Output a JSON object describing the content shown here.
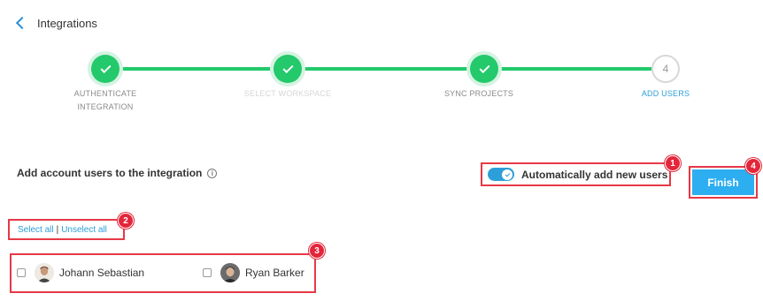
{
  "header": {
    "back_label": "Integrations"
  },
  "stepper": {
    "steps": [
      {
        "label_line1": "AUTHENTICATE",
        "label_line2": "INTEGRATION",
        "status": "done"
      },
      {
        "label_line1": "SELECT WORKSPACE",
        "label_line2": "",
        "status": "done-faded"
      },
      {
        "label_line1": "SYNC PROJECTS",
        "label_line2": "",
        "status": "done"
      },
      {
        "label_line1": "ADD USERS",
        "label_line2": "",
        "status": "current",
        "number": "4"
      }
    ]
  },
  "main": {
    "add_users_label": "Add account users to the integration",
    "info_icon_glyph": "i",
    "auto_add_label": "Automatically add new users",
    "auto_add_enabled": true,
    "finish_label": "Finish",
    "select_all_label": "Select all",
    "separator": "|",
    "unselect_all_label": "Unselect all",
    "users": [
      {
        "name": "Johann Sebastian",
        "checked": false
      },
      {
        "name": "Ryan Barker",
        "checked": false
      }
    ]
  },
  "annotations": {
    "badges": [
      "1",
      "2",
      "3",
      "4"
    ]
  },
  "colors": {
    "accent": "#2d9fd8",
    "success": "#23c96b",
    "highlight": "#e63946",
    "button": "#2daef0"
  }
}
